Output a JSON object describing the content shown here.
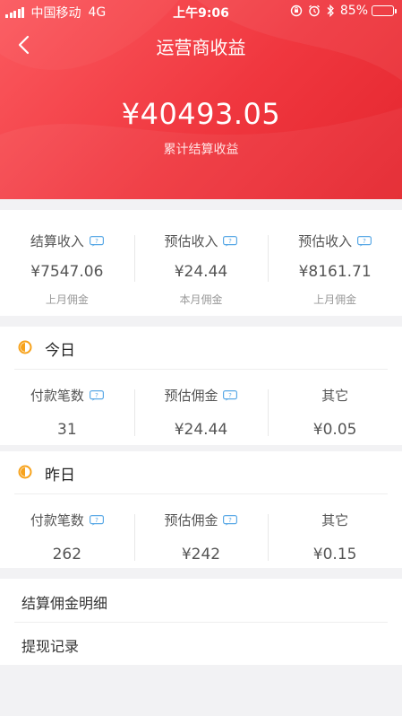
{
  "status_bar": {
    "carrier": "中国移动",
    "network": "4G",
    "time": "上午9:06",
    "battery": "85%",
    "battery_level": 0.85,
    "battery_color": "#ffc21a"
  },
  "nav": {
    "title": "运营商收益",
    "back_icon": "chevron-left-icon"
  },
  "header": {
    "total": "¥40493.05",
    "total_label": "累计结算收益",
    "gradient": [
      "#fb5a5f",
      "#e4262e"
    ]
  },
  "summary": [
    {
      "label": "结算收入",
      "value": "¥7547.06",
      "sub": "上月佣金"
    },
    {
      "label": "预估收入",
      "value": "¥24.44",
      "sub": "本月佣金"
    },
    {
      "label": "预估收入",
      "value": "¥8161.71",
      "sub": "上月佣金"
    }
  ],
  "today": {
    "title": "今日",
    "items": [
      {
        "label": "付款笔数",
        "value": "31",
        "help": true
      },
      {
        "label": "预估佣金",
        "value": "¥24.44",
        "help": true
      },
      {
        "label": "其它",
        "value": "¥0.05",
        "help": false
      }
    ]
  },
  "yesterday": {
    "title": "昨日",
    "items": [
      {
        "label": "付款笔数",
        "value": "262",
        "help": true
      },
      {
        "label": "预估佣金",
        "value": "¥242",
        "help": true
      },
      {
        "label": "其它",
        "value": "¥0.15",
        "help": false
      }
    ]
  },
  "links": [
    {
      "label": "结算佣金明细"
    },
    {
      "label": "提现记录"
    }
  ],
  "colors": {
    "accent": "#f0373f",
    "help_icon": "#5aa9e6",
    "section_icon": "#f7a21b"
  }
}
